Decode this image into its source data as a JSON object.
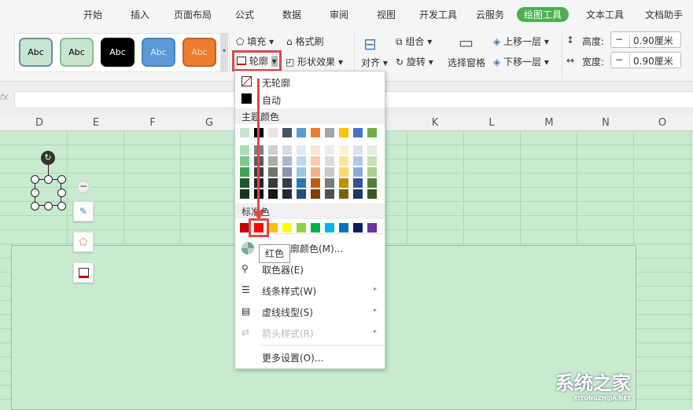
{
  "tabs": [
    "开始",
    "插入",
    "页面布局",
    "公式",
    "数据",
    "审阅",
    "视图",
    "开发工具",
    "云服务",
    "绘图工具",
    "文本工具",
    "文档助手"
  ],
  "active_tab": "绘图工具",
  "style_presets": [
    {
      "label": "Abc",
      "bg": "#c6e6cf",
      "border": "#6a8fa0",
      "fg": "#000"
    },
    {
      "label": "Abc",
      "bg": "#c6e6cf",
      "border": "#90b890",
      "fg": "#000"
    },
    {
      "label": "Abc",
      "bg": "#000000",
      "border": "#000",
      "fg": "#fff"
    },
    {
      "label": "Abc",
      "bg": "#5b9bd5",
      "border": "#4a84b8",
      "fg": "#dbe9f7"
    },
    {
      "label": "Abc",
      "bg": "#ed7d31",
      "border": "#c5621f",
      "fg": "#f7d8c0"
    }
  ],
  "ribbon": {
    "fill": "填充",
    "format_painter": "格式刷",
    "outline": "轮廓",
    "shape_effect": "形状效果",
    "align": "对齐",
    "group": "组合",
    "rotate": "旋转",
    "selection_pane": "选择窗格",
    "bring_forward": "上移一层",
    "send_backward": "下移一层",
    "height_label": "高度:",
    "height_value": "0.90厘米",
    "width_label": "宽度:",
    "width_value": "0.90厘米"
  },
  "formula_bar": {
    "fx": "fx",
    "value": ""
  },
  "columns": [
    "D",
    "E",
    "F",
    "G",
    "K",
    "L",
    "M",
    "N",
    "O"
  ],
  "menu": {
    "no_outline": "无轮廓",
    "auto": "自动",
    "theme_colors_title": "主题颜色",
    "standard_colors_title": "标准色",
    "more_colors": "其他轮廓颜色(M)...",
    "eyedropper": "取色器(E)",
    "line_style": "线条样式(W)",
    "dash_type": "虚线线型(S)",
    "arrow_style": "箭头样式(R)",
    "more_settings": "更多设置(O)..."
  },
  "theme_colors": [
    "#c6e6cf",
    "#000000",
    "#e7e6e6",
    "#44546a",
    "#5b9bd5",
    "#ed7d31",
    "#a5a5a5",
    "#ffc000",
    "#4472c4",
    "#70ad47"
  ],
  "theme_shades": [
    [
      "#a9dcb4",
      "#7f7f7f",
      "#d0cece",
      "#d6dce4",
      "#deebf6",
      "#fbe5d5",
      "#ededed",
      "#fff2cc",
      "#d9e2f3",
      "#e2efd9"
    ],
    [
      "#7bc98c",
      "#595959",
      "#aeaaaa",
      "#adb9ca",
      "#bdd7ee",
      "#f7cbac",
      "#dbdbdb",
      "#fee599",
      "#b4c6e7",
      "#c5e0b3"
    ],
    [
      "#3aa655",
      "#3f3f3f",
      "#757171",
      "#8496b0",
      "#9cc3e5",
      "#f4b183",
      "#c9c9c9",
      "#ffd965",
      "#8eaadb",
      "#a8d08d"
    ],
    [
      "#1e5a2c",
      "#262626",
      "#3a3838",
      "#323f4f",
      "#2e75b5",
      "#c55a11",
      "#7b7b7b",
      "#bf9000",
      "#2f5496",
      "#538135"
    ],
    [
      "#12381b",
      "#0d0d0d",
      "#171616",
      "#222a35",
      "#1e4e79",
      "#833c0b",
      "#525252",
      "#7f6000",
      "#1f3864",
      "#375623"
    ]
  ],
  "standard_colors": [
    "#c00000",
    "#ff0000",
    "#ffc000",
    "#ffff00",
    "#92d050",
    "#00b050",
    "#00b0f0",
    "#0070c0",
    "#002060",
    "#7030a0"
  ],
  "tooltip": "红色",
  "watermark": {
    "text": "系统之家",
    "sub": "XITONGZHIJIA.NET"
  }
}
